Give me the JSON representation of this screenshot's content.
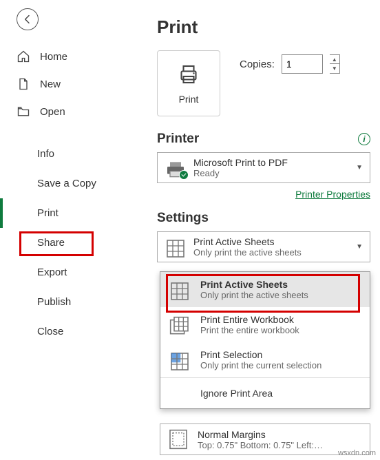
{
  "page_title": "Print",
  "sidebar": {
    "items": [
      {
        "label": "Home"
      },
      {
        "label": "New"
      },
      {
        "label": "Open"
      }
    ],
    "sub_items": [
      {
        "label": "Info"
      },
      {
        "label": "Save a Copy"
      },
      {
        "label": "Print"
      },
      {
        "label": "Share"
      },
      {
        "label": "Export"
      },
      {
        "label": "Publish"
      },
      {
        "label": "Close"
      }
    ]
  },
  "print_button": {
    "label": "Print"
  },
  "copies": {
    "label": "Copies:",
    "value": "1"
  },
  "printer_section": {
    "title": "Printer",
    "selected": {
      "name": "Microsoft Print to PDF",
      "status": "Ready"
    },
    "properties_link": "Printer Properties"
  },
  "settings_section": {
    "title": "Settings",
    "selected": {
      "title": "Print Active Sheets",
      "sub": "Only print the active sheets"
    },
    "options": [
      {
        "title": "Print Active Sheets",
        "sub": "Only print the active sheets"
      },
      {
        "title": "Print Entire Workbook",
        "sub": "Print the entire workbook"
      },
      {
        "title": "Print Selection",
        "sub": "Only print the current selection"
      }
    ],
    "ignore": "Ignore Print Area",
    "margins": {
      "title": "Normal Margins",
      "sub": "Top: 0.75\" Bottom: 0.75\" Left:…"
    }
  },
  "watermark": "wsxdn.com"
}
